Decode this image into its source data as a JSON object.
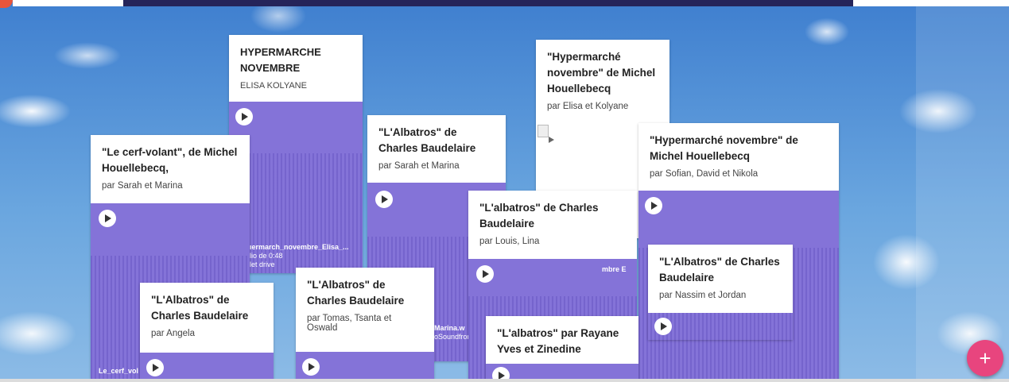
{
  "cards": {
    "hypermarche_elisa": {
      "title": "HYPERMARCHE NOVEMBRE",
      "sub": "ELISA KOLYANE",
      "file_line1": "ıermarch_novembre_Elisa_...",
      "file_line2": "lio de 0:48",
      "file_line3": "let drive"
    },
    "cerf_volant": {
      "title": "\"Le cerf-volant\", de Michel Houellebecq,",
      "sub": "par Sarah et Marina",
      "file_line1": "Le_cerf_vol"
    },
    "albatros_sarah": {
      "title": "\"L'Albatros\" de Charles Baudelaire",
      "sub": "par Sarah et Marina",
      "file_line1": "Marina.w",
      "file_line2": "oSoundfront"
    },
    "hypermarche_michel": {
      "title": "\"Hypermarché novembre\" de Michel Houellebecq",
      "sub": "par Elisa et Kolyane"
    },
    "hypermarche_sofian": {
      "title": "\"Hypermarché novembre\" de Michel Houellebecq",
      "sub": "par Sofian, David et Nikola",
      "file_line1": "mbre E"
    },
    "albatros_louis": {
      "title": "\"L'albatros\" de Charles Baudelaire",
      "sub": "par Louis, Lina"
    },
    "albatros_nassim": {
      "title": "\"L'Albatros\" de Charles Baudelaire",
      "sub": "par Nassim et Jordan"
    },
    "albatros_angela": {
      "title": "\"L'Albatros\" de Charles Baudelaire",
      "sub": "par Angela"
    },
    "albatros_tomas": {
      "title": "\"L'Albatros\" de Charles Baudelaire",
      "sub": "par Tomas, Tsanta et Oswald"
    },
    "albatros_rayane": {
      "title": "\"L'albatros\" par Rayane Yves et Zinedine"
    }
  },
  "fab": {
    "label": "+"
  },
  "colors": {
    "player": "#8473d8",
    "fab": "#e8457e",
    "top_bar": "#25245a"
  }
}
